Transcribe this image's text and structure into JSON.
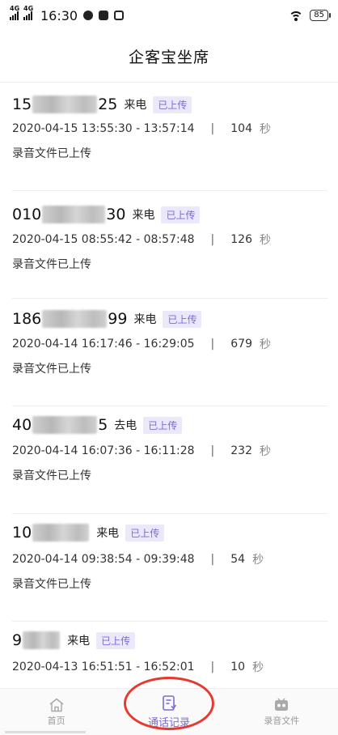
{
  "status_bar": {
    "network_1": "4G",
    "network_2": "4G",
    "time": "16:30",
    "battery": "85"
  },
  "header": {
    "title": "企客宝坐席"
  },
  "records": [
    {
      "phone_prefix": "15",
      "phone_suffix": "25",
      "direction": "来电",
      "badge": "已上传",
      "time_range": "2020-04-15 13:55:30 - 13:57:14",
      "separator": "|",
      "duration": "104",
      "unit": "秒",
      "status": "录音文件已上传"
    },
    {
      "phone_prefix": "010",
      "phone_suffix": "30",
      "direction": "来电",
      "badge": "已上传",
      "time_range": "2020-04-15 08:55:42 - 08:57:48",
      "separator": "|",
      "duration": "126",
      "unit": "秒",
      "status": "录音文件已上传"
    },
    {
      "phone_prefix": "186",
      "phone_suffix": "99",
      "direction": "来电",
      "badge": "已上传",
      "time_range": "2020-04-14 16:17:46 - 16:29:05",
      "separator": "|",
      "duration": "679",
      "unit": "秒",
      "status": "录音文件已上传"
    },
    {
      "phone_prefix": "40",
      "phone_suffix": "5",
      "direction": "去电",
      "badge": "已上传",
      "time_range": "2020-04-14 16:07:36 - 16:11:28",
      "separator": "|",
      "duration": "232",
      "unit": "秒",
      "status": "录音文件已上传"
    },
    {
      "phone_prefix": "10",
      "phone_suffix": "",
      "direction": "来电",
      "badge": "已上传",
      "time_range": "2020-04-14 09:38:54 - 09:39:48",
      "separator": "|",
      "duration": "54",
      "unit": "秒",
      "status": "录音文件已上传"
    },
    {
      "phone_prefix": "9",
      "phone_suffix": "",
      "direction": "来电",
      "badge": "已上传",
      "time_range": "2020-04-13 16:51:51 - 16:52:01",
      "separator": "|",
      "duration": "10",
      "unit": "秒",
      "status": ""
    }
  ],
  "tabbar": {
    "tabs": [
      {
        "label": "首页",
        "icon": "home-icon",
        "active": false
      },
      {
        "label": "通话记录",
        "icon": "call-log-icon",
        "active": true
      },
      {
        "label": "录音文件",
        "icon": "recording-icon",
        "active": false
      }
    ]
  },
  "colors": {
    "accent": "#7d6bd6",
    "badge_bg": "#ece8fb",
    "annotation": "#e63a30"
  }
}
